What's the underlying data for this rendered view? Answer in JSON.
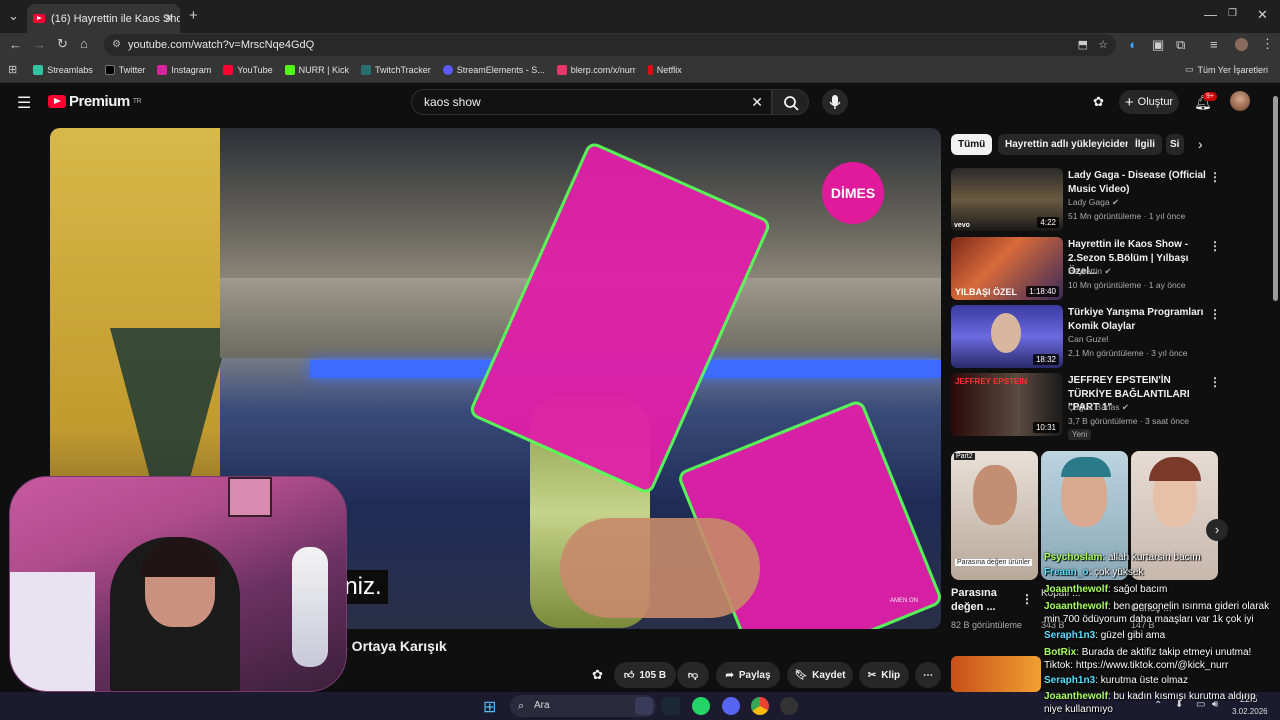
{
  "browser": {
    "tab_title": "(16) Hayrettin ile Kaos Show - 2",
    "url": "youtube.com/watch?v=MrscNqe4GdQ",
    "bookmarks": [
      "Streamlabs",
      "Twitter",
      "Instagram",
      "YouTube",
      "NURR | Kick",
      "TwitchTracker",
      "StreamElements - S...",
      "blerp.com/x/nurr",
      "Netflix"
    ],
    "all_bookmarks": "Tüm Yer İşaretleri"
  },
  "youtube": {
    "logo_text": "Premium",
    "logo_region": "TR",
    "search_value": "kaos show",
    "create_label": "Oluştur",
    "notification_count": "9+"
  },
  "video": {
    "caption": "iniz.",
    "brand_logo": "DİMES",
    "title_partial": "s Ortaya Karışık",
    "watermark": "AMEN ON"
  },
  "actions": {
    "like_count": "105 B",
    "share": "Paylaş",
    "save": "Kaydet",
    "clip": "Klip"
  },
  "chips": [
    "Tümü",
    "Hayrettin adlı yükleyiciden",
    "İlgili",
    "Si"
  ],
  "recommendations": [
    {
      "title": "Lady Gaga - Disease (Official Music Video)",
      "channel": "Lady Gaga",
      "meta": "51 Mn görüntüleme · 1 yıl önce",
      "duration": "4:22",
      "thumb_label": "vevo"
    },
    {
      "title": "Hayrettin ile Kaos Show - 2.Sezon 5.Bölüm | Yılbaşı Özel...",
      "channel": "Hayrettin",
      "meta": "10 Mn görüntüleme · 1 ay önce",
      "duration": "1:18:40",
      "thumb_label": "YILBAŞI ÖZEL"
    },
    {
      "title": "Türkiye Yarışma Programları Komik Olaylar",
      "channel": "Can Guzel",
      "meta": "2,1 Mn görüntüleme · 3 yıl önce",
      "duration": "18:32",
      "thumb_label": ""
    },
    {
      "title": "JEFFREY EPSTEIN'İN TÜRKİYE BAĞLANTILARI \"PART 1\"",
      "channel": "Çağlar Barlas",
      "meta": "3,7 B görüntüleme · 3 saat önce",
      "duration": "10:31",
      "badge": "Yeni",
      "thumb_label": "JEFFREY EPSTEIN"
    }
  ],
  "shorts": {
    "items": [
      {
        "thumb_tag": "Part2",
        "thumb_caption": "Parasına değen ürünler",
        "title": "Parasına değen ...",
        "views": "82 B görüntüleme"
      },
      {
        "title": "Kopalı ...",
        "views": "343 B"
      },
      {
        "title": "Güneş ...",
        "views": "147 B"
      }
    ]
  },
  "chat": [
    {
      "user": "Psychoslam",
      "text": ": allah kurtarsın bacım"
    },
    {
      "user": "Freaan_o",
      "text": ": çok yüksek"
    },
    {
      "user": "Joaanthewolf",
      "text": ": sağol bacım"
    },
    {
      "user": "Joaanthewolf",
      "text": ": ben personelin ısınma gideri olarak min 700 ödüyorum daha maaşları var 1k çok iyi"
    },
    {
      "user": "Seraph1n3",
      "text": ": güzel gibi ama"
    },
    {
      "user": "BotRix",
      "text": ": Burada de aktifiz takip etmeyi unutma! Tiktok: https://www.tiktok.com/@kick_nurr"
    },
    {
      "user": "Seraph1n3",
      "text": ": kurutma üste olmaz"
    },
    {
      "user": "Joaanthewolf",
      "text": ": bu kadın kısmışı kurutma aldırıp niye kullanmıyo"
    }
  ],
  "taskbar": {
    "search_placeholder": "Ara",
    "time": "22:5",
    "date": "3.02.2026"
  }
}
